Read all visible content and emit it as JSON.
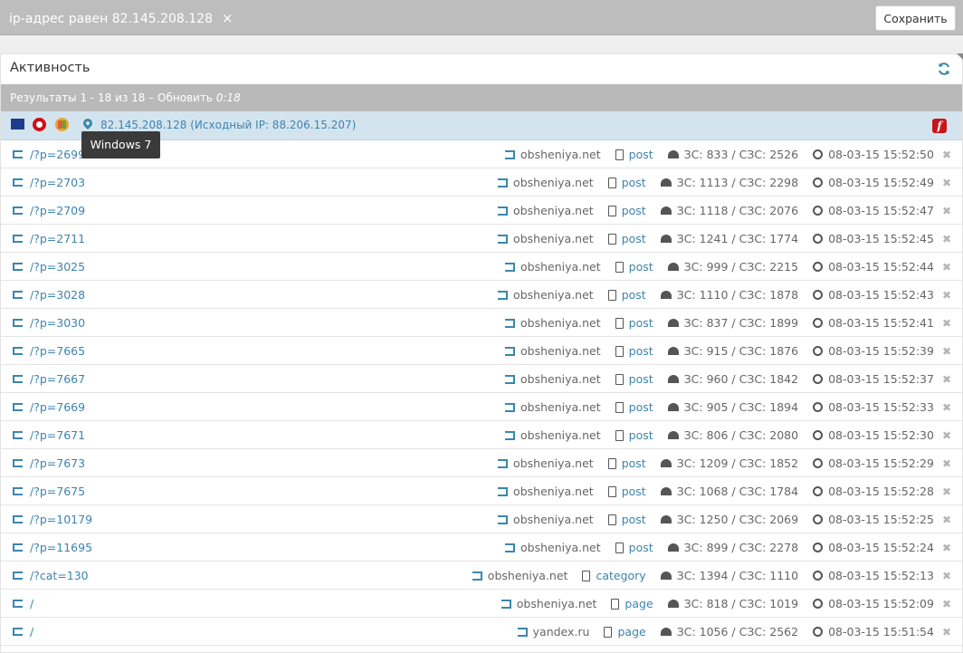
{
  "topbar": {
    "filter_label": "ip-адрес равен 82.145.208.128",
    "remove_icon": "×",
    "save_label": "Сохранить"
  },
  "panel": {
    "title": "Активность",
    "refresh_icon": "refresh-icon"
  },
  "results": {
    "text": "Результаты 1 - 18 из 18 – Обновить",
    "countdown": "0:18"
  },
  "session": {
    "ip_text": "82.145.208.128 (Исходный IP: 88.206.15.207)",
    "tooltip": "Windows 7",
    "colors": {
      "flash": "#c7161a",
      "accent": "#3d84ad",
      "opera": "#cc0f16"
    }
  },
  "rows": [
    {
      "path": "/?p=2699",
      "referrer": "obsheniya.net",
      "type": "post",
      "metrics": "ЗС: 833 / СЗС: 2526",
      "time": "08-03-15 15:52:50"
    },
    {
      "path": "/?p=2703",
      "referrer": "obsheniya.net",
      "type": "post",
      "metrics": "ЗС: 1113 / СЗС: 2298",
      "time": "08-03-15 15:52:49"
    },
    {
      "path": "/?p=2709",
      "referrer": "obsheniya.net",
      "type": "post",
      "metrics": "ЗС: 1118 / СЗС: 2076",
      "time": "08-03-15 15:52:47"
    },
    {
      "path": "/?p=2711",
      "referrer": "obsheniya.net",
      "type": "post",
      "metrics": "ЗС: 1241 / СЗС: 1774",
      "time": "08-03-15 15:52:45"
    },
    {
      "path": "/?p=3025",
      "referrer": "obsheniya.net",
      "type": "post",
      "metrics": "ЗС: 999 / СЗС: 2215",
      "time": "08-03-15 15:52:44"
    },
    {
      "path": "/?p=3028",
      "referrer": "obsheniya.net",
      "type": "post",
      "metrics": "ЗС: 1110 / СЗС: 1878",
      "time": "08-03-15 15:52:43"
    },
    {
      "path": "/?p=3030",
      "referrer": "obsheniya.net",
      "type": "post",
      "metrics": "ЗС: 837 / СЗС: 1899",
      "time": "08-03-15 15:52:41"
    },
    {
      "path": "/?p=7665",
      "referrer": "obsheniya.net",
      "type": "post",
      "metrics": "ЗС: 915 / СЗС: 1876",
      "time": "08-03-15 15:52:39"
    },
    {
      "path": "/?p=7667",
      "referrer": "obsheniya.net",
      "type": "post",
      "metrics": "ЗС: 960 / СЗС: 1842",
      "time": "08-03-15 15:52:37"
    },
    {
      "path": "/?p=7669",
      "referrer": "obsheniya.net",
      "type": "post",
      "metrics": "ЗС: 905 / СЗС: 1894",
      "time": "08-03-15 15:52:33"
    },
    {
      "path": "/?p=7671",
      "referrer": "obsheniya.net",
      "type": "post",
      "metrics": "ЗС: 806 / СЗС: 2080",
      "time": "08-03-15 15:52:30"
    },
    {
      "path": "/?p=7673",
      "referrer": "obsheniya.net",
      "type": "post",
      "metrics": "ЗС: 1209 / СЗС: 1852",
      "time": "08-03-15 15:52:29"
    },
    {
      "path": "/?p=7675",
      "referrer": "obsheniya.net",
      "type": "post",
      "metrics": "ЗС: 1068 / СЗС: 1784",
      "time": "08-03-15 15:52:28"
    },
    {
      "path": "/?p=10179",
      "referrer": "obsheniya.net",
      "type": "post",
      "metrics": "ЗС: 1250 / СЗС: 2069",
      "time": "08-03-15 15:52:25"
    },
    {
      "path": "/?p=11695",
      "referrer": "obsheniya.net",
      "type": "post",
      "metrics": "ЗС: 899 / СЗС: 2278",
      "time": "08-03-15 15:52:24"
    },
    {
      "path": "/?cat=130",
      "referrer": "obsheniya.net",
      "type": "category",
      "metrics": "ЗС: 1394 / СЗС: 1110",
      "time": "08-03-15 15:52:13"
    },
    {
      "path": "/",
      "referrer": "obsheniya.net",
      "type": "page",
      "metrics": "ЗС: 818 / СЗС: 1019",
      "time": "08-03-15 15:52:09"
    },
    {
      "path": "/",
      "referrer": "yandex.ru",
      "type": "page",
      "metrics": "ЗС: 1056 / СЗС: 2562",
      "time": "08-03-15 15:51:54"
    }
  ]
}
